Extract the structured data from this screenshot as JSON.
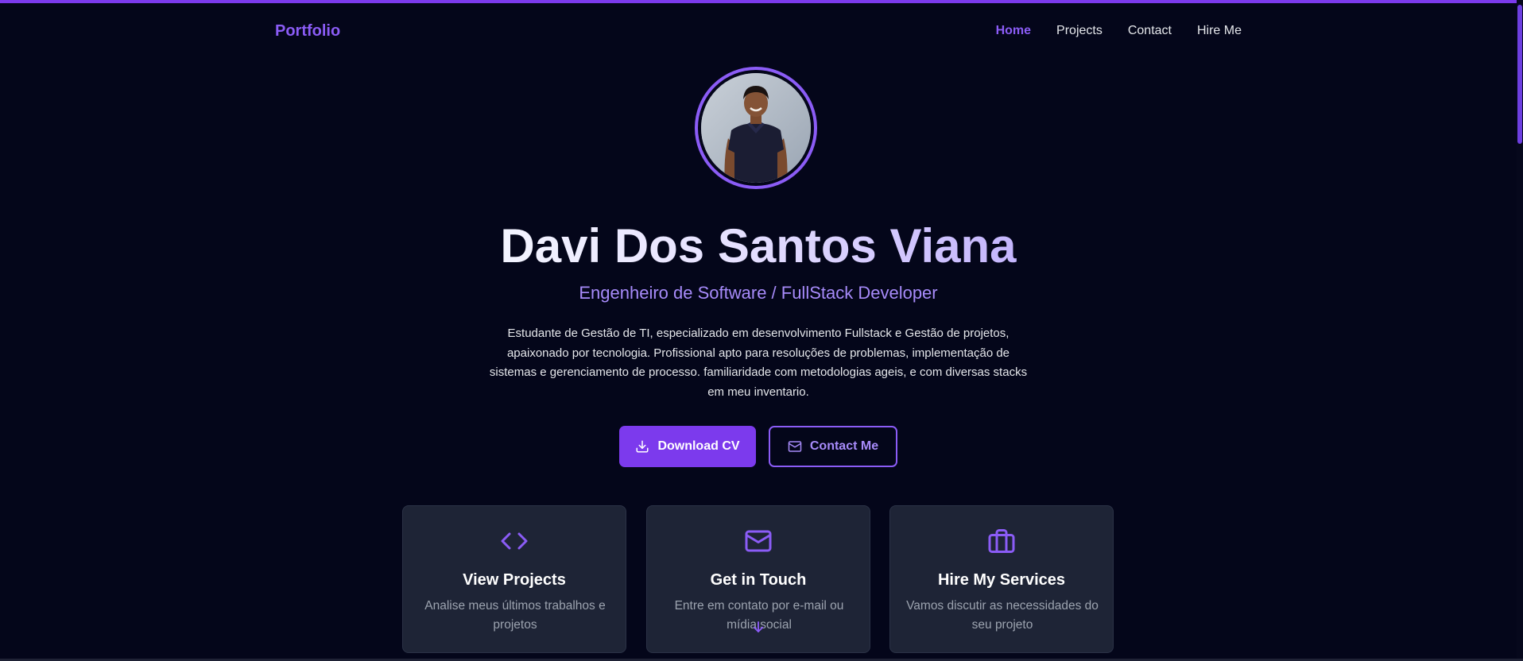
{
  "brand": "Portfolio",
  "nav": {
    "items": [
      {
        "label": "Home",
        "active": true
      },
      {
        "label": "Projects",
        "active": false
      },
      {
        "label": "Contact",
        "active": false
      },
      {
        "label": "Hire Me",
        "active": false
      }
    ]
  },
  "hero": {
    "avatar_icon": "profile-photo",
    "name": "Davi Dos Santos Viana",
    "subtitle": "Engenheiro de Software / FullStack Developer",
    "bio": "Estudante de Gestão de TI, especializado em desenvolvimento Fullstack e Gestão de projetos, apaixonado por tecnologia. Profissional apto para resoluções de problemas, implementação de sistemas e gerenciamento de processo. familiaridade com metodologias ageis, e com diversas stacks em meu inventario."
  },
  "actions": {
    "download_cv": {
      "label": "Download CV",
      "icon": "download-icon"
    },
    "contact_me": {
      "label": "Contact Me",
      "icon": "mail-icon"
    }
  },
  "cards": [
    {
      "title": "View Projects",
      "description": "Analise meus últimos trabalhos e projetos",
      "icon": "code-icon"
    },
    {
      "title": "Get in Touch",
      "description": "Entre em contato por e-mail ou mídia social",
      "icon": "mail-icon"
    },
    {
      "title": "Hire My Services",
      "description": "Vamos discutir as necessidades do seu projeto",
      "icon": "briefcase-icon"
    }
  ],
  "colors": {
    "background": "#04061a",
    "accent": "#7c3aed",
    "accent_light": "#8b5cf6",
    "subtitle": "#a78bfa",
    "card_bg": "#1e2436",
    "muted_text": "#9ca3af"
  }
}
